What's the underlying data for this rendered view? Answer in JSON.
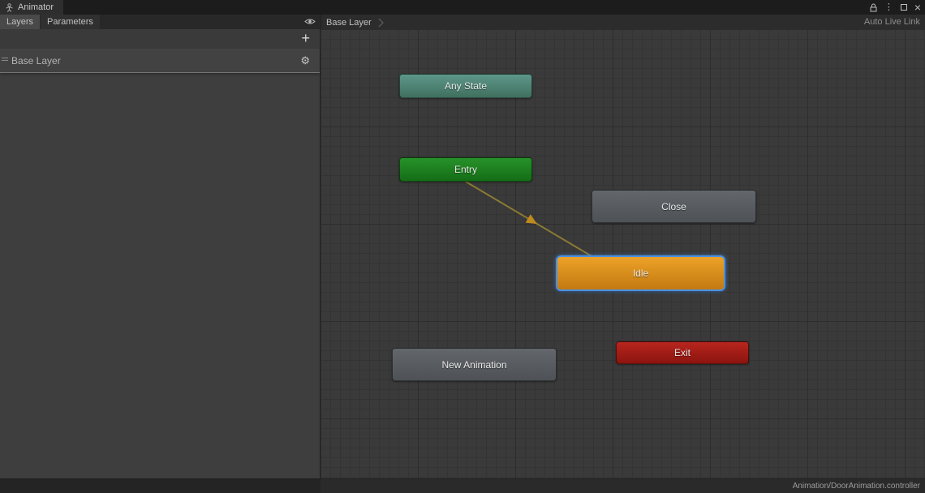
{
  "window": {
    "title": "Animator",
    "status_path": "Animation/DoorAnimation.controller"
  },
  "header": {
    "tabs": [
      {
        "label": "Layers",
        "active": true
      },
      {
        "label": "Parameters",
        "active": false
      }
    ],
    "breadcrumb": "Base Layer",
    "auto_live_link": "Auto Live Link"
  },
  "sidebar": {
    "add_button": "+",
    "layer": {
      "name": "Base Layer"
    }
  },
  "canvas": {
    "nodes": {
      "any_state": {
        "label": "Any State",
        "color": "#4d8677"
      },
      "entry": {
        "label": "Entry",
        "color": "#1e7d1e"
      },
      "close": {
        "label": "Close",
        "color": "#585c60"
      },
      "idle": {
        "label": "Idle",
        "color": "#d78d20",
        "selected": true,
        "selection_color": "#4c90df"
      },
      "new_animation": {
        "label": "New Animation",
        "color": "#585c60"
      },
      "exit": {
        "label": "Exit",
        "color": "#a81f19"
      }
    },
    "transitions": [
      {
        "from": "entry",
        "to": "idle",
        "line_color": "#8a7a33",
        "arrow_color": "#c08a1e"
      }
    ]
  }
}
